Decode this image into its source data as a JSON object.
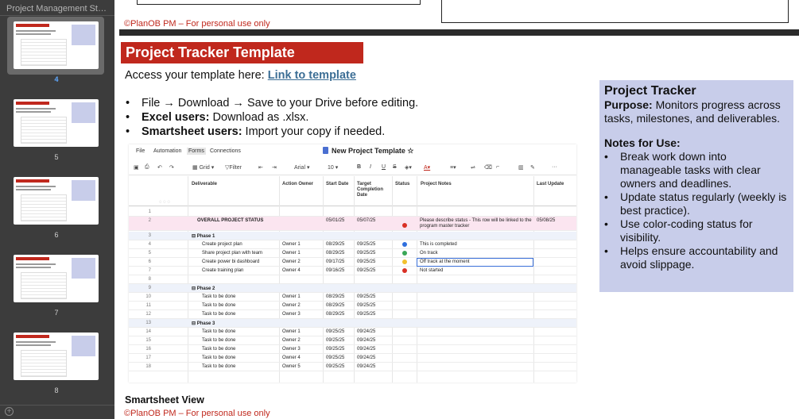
{
  "sidebar": {
    "doc_title": "Project Management Sta...",
    "thumbs": [
      {
        "num": "4",
        "selected": true
      },
      {
        "num": "5",
        "selected": false
      },
      {
        "num": "6",
        "selected": false
      },
      {
        "num": "7",
        "selected": false
      },
      {
        "num": "8",
        "selected": false
      }
    ]
  },
  "prev_slide": {
    "footer": "©PlanOB PM – For personal use only"
  },
  "slide": {
    "title": "Project Tracker Template",
    "access_prefix": "Access your template here: ",
    "access_link": "Link to template",
    "bullets": [
      {
        "bold": "",
        "text": "File →  Download → Save to your Drive before editing."
      },
      {
        "bold": "Excel users:",
        "text": " Download as .xlsx."
      },
      {
        "bold": "Smartsheet users:",
        "text": " Import your copy if needed."
      }
    ],
    "info": {
      "heading": "Project Tracker",
      "purpose_label": "Purpose:",
      "purpose_text": " Monitors progress across tasks, milestones, and deliverables.",
      "notes_heading": "Notes for Use:",
      "notes": [
        "Break work down into manageable tasks with clear owners and deadlines.",
        "Update status regularly (weekly is best practice).",
        "Use color-coding  status for visibility.",
        "Helps ensure accountability and avoid slippage."
      ]
    },
    "sheet_caption": "Smartsheet View",
    "footer": "©PlanOB PM – For personal use only"
  },
  "sheet": {
    "menu": [
      "File",
      "Automation",
      "Forms",
      "Connections"
    ],
    "active_menu": "Forms",
    "doc_title": "New Project Template",
    "toolbar": {
      "grid": "Grid",
      "filter": "Filter",
      "font": "Arial",
      "size": "10"
    },
    "columns": [
      "Deliverable",
      "Action Owner",
      "Start Date",
      "Target Completion Date",
      "Status",
      "Project Notes",
      "Last Update"
    ],
    "status_colors": {
      "red": "#d93025",
      "blue": "#2f6fde",
      "green": "#3aa757",
      "yellow": "#f2c12e"
    },
    "rows": [
      {
        "n": "1",
        "kind": "blank"
      },
      {
        "n": "2",
        "kind": "overall",
        "deliverable": "OVERALL PROJECT STATUS",
        "start": "05/01/25",
        "target": "05/07/25",
        "status": "red",
        "notes": "Please describe status - This row will be linked to the program master tracker",
        "last": "05/08/25"
      },
      {
        "n": "3",
        "kind": "phase",
        "deliverable": "Phase 1"
      },
      {
        "n": "4",
        "kind": "task",
        "deliverable": "Create project plan",
        "owner": "Owner 1",
        "start": "08/29/25",
        "target": "09/25/25",
        "status": "blue",
        "notes": "This is completed"
      },
      {
        "n": "5",
        "kind": "task",
        "deliverable": "Share project plan with team",
        "owner": "Owner 1",
        "start": "08/29/25",
        "target": "09/25/25",
        "status": "green",
        "notes": "On track"
      },
      {
        "n": "6",
        "kind": "task",
        "deliverable": "Create power bi dashboard",
        "owner": "Owner 2",
        "start": "09/17/25",
        "target": "09/25/25",
        "status": "yellow",
        "notes": "Off track at the moment"
      },
      {
        "n": "7",
        "kind": "task",
        "deliverable": "Create training plan",
        "owner": "Owner 4",
        "start": "09/16/25",
        "target": "09/25/25",
        "status": "red",
        "notes": "Not started"
      },
      {
        "n": "8",
        "kind": "blank"
      },
      {
        "n": "9",
        "kind": "phase",
        "deliverable": "Phase 2"
      },
      {
        "n": "10",
        "kind": "task",
        "deliverable": "Task to be done",
        "owner": "Owner 1",
        "start": "08/29/25",
        "target": "09/25/25"
      },
      {
        "n": "11",
        "kind": "task",
        "deliverable": "Task to be done",
        "owner": "Owner 2",
        "start": "08/29/25",
        "target": "09/25/25"
      },
      {
        "n": "12",
        "kind": "task",
        "deliverable": "Task to be done",
        "owner": "Owner 3",
        "start": "08/29/25",
        "target": "09/25/25"
      },
      {
        "n": "13",
        "kind": "phase",
        "deliverable": "Phase 3"
      },
      {
        "n": "14",
        "kind": "task",
        "deliverable": "Task to be done",
        "owner": "Owner 1",
        "start": "09/25/25",
        "target": "09/24/25"
      },
      {
        "n": "15",
        "kind": "task",
        "deliverable": "Task to be done",
        "owner": "Owner 2",
        "start": "09/25/25",
        "target": "09/24/25"
      },
      {
        "n": "16",
        "kind": "task",
        "deliverable": "Task to be done",
        "owner": "Owner 3",
        "start": "09/25/25",
        "target": "09/24/25"
      },
      {
        "n": "17",
        "kind": "task",
        "deliverable": "Task to be done",
        "owner": "Owner 4",
        "start": "09/25/25",
        "target": "09/24/25"
      },
      {
        "n": "18",
        "kind": "task",
        "deliverable": "Task to be done",
        "owner": "Owner 5",
        "start": "09/25/25",
        "target": "09/24/25"
      }
    ]
  }
}
